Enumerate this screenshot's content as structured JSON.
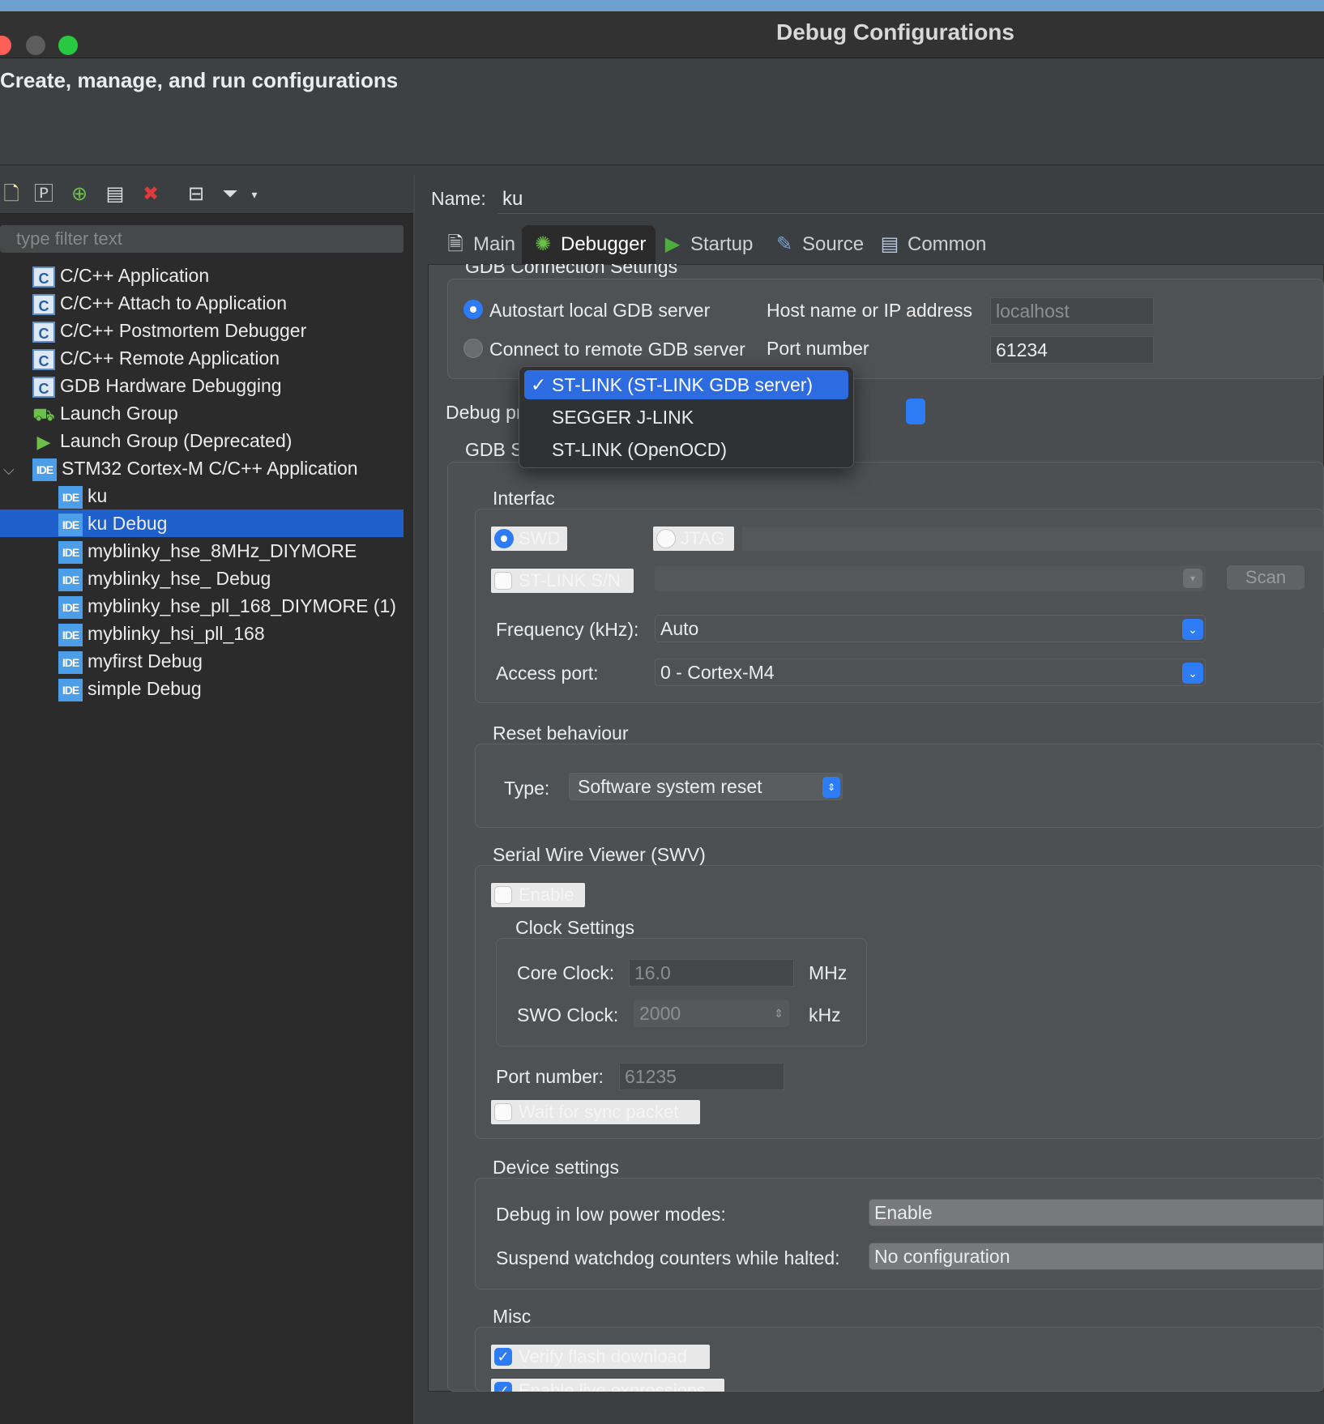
{
  "window": {
    "title": "Debug Configurations",
    "header": "Create, manage, and run configurations",
    "colors": {
      "accent": "#2d7cf6",
      "selection": "#1f5fcc"
    }
  },
  "left": {
    "toolbar": [
      "new-configuration-icon",
      "new-prototype-icon",
      "export-icon",
      "duplicate-icon",
      "delete-icon",
      "collapse-all-icon",
      "filter-icon"
    ],
    "filter_placeholder": "type filter text",
    "tree": [
      {
        "label": "C/C++ Application",
        "icon": "c-icon"
      },
      {
        "label": "C/C++ Attach to Application",
        "icon": "c-icon"
      },
      {
        "label": "C/C++ Postmortem Debugger",
        "icon": "c-icon"
      },
      {
        "label": "C/C++ Remote Application",
        "icon": "c-icon"
      },
      {
        "label": "GDB Hardware Debugging",
        "icon": "c-icon"
      },
      {
        "label": "Launch Group",
        "icon": "launch-group-icon"
      },
      {
        "label": "Launch Group (Deprecated)",
        "icon": "launch-group-icon"
      },
      {
        "label": "STM32 Cortex-M C/C++ Application",
        "icon": "ide-icon"
      },
      {
        "label": "ku",
        "icon": "ide-icon"
      },
      {
        "label": "ku Debug",
        "icon": "ide-icon"
      },
      {
        "label": "myblinky_hse_8MHz_DIYMORE",
        "icon": "ide-icon"
      },
      {
        "label": "myblinky_hse_ Debug",
        "icon": "ide-icon"
      },
      {
        "label": "myblinky_hse_pll_168_DIYMORE (1)",
        "icon": "ide-icon"
      },
      {
        "label": "myblinky_hsi_pll_168",
        "icon": "ide-icon"
      },
      {
        "label": "myfirst Debug",
        "icon": "ide-icon"
      },
      {
        "label": "simple Debug",
        "icon": "ide-icon"
      }
    ],
    "ide_icon_text": "IDE",
    "c_icon_text": "C"
  },
  "right": {
    "name_label": "Name:",
    "name_value": "ku",
    "tabs": [
      "Main",
      "Debugger",
      "Startup",
      "Source",
      "Common"
    ],
    "active_tab": "Debugger",
    "gdb_connection": {
      "title": "GDB Connection Settings",
      "autostart": "Autostart local GDB server",
      "remote": "Connect to remote GDB server",
      "host_label": "Host name or IP address",
      "host_value": "localhost",
      "port_label": "Port number",
      "port_value": "61234"
    },
    "debug_probe": {
      "label": "Debug probe",
      "options": [
        "ST-LINK (ST-LINK GDB server)",
        "SEGGER J-LINK",
        "ST-LINK (OpenOCD)"
      ],
      "selected": "ST-LINK (ST-LINK GDB server)",
      "check": "✓"
    },
    "gdb_server": {
      "title": "GDB Serve",
      "interface_title": "Interfac",
      "swd": "SWD",
      "jtag": "JTAG",
      "stlink_sn": "ST-LINK S/N",
      "scan": "Scan",
      "frequency_label": "Frequency (kHz):",
      "frequency_value": "Auto",
      "access_port_label": "Access port:",
      "access_port_value": "0 - Cortex-M4"
    },
    "reset": {
      "title": "Reset behaviour",
      "type_label": "Type:",
      "type_value": "Software system reset"
    },
    "swv": {
      "title": "Serial Wire Viewer (SWV)",
      "enable": "Enable",
      "clock_title": "Clock Settings",
      "core_clock_label": "Core Clock:",
      "core_clock_value": "16.0",
      "core_clock_unit": "MHz",
      "swo_clock_label": "SWO Clock:",
      "swo_clock_value": "2000",
      "swo_clock_unit": "kHz",
      "port_label": "Port number:",
      "port_value": "61235",
      "wait_sync": "Wait for sync packet"
    },
    "device": {
      "title": "Device settings",
      "low_power_label": "Debug in low power modes:",
      "low_power_value": "Enable",
      "watchdog_label": "Suspend watchdog counters while halted:",
      "watchdog_value": "No configuration"
    },
    "misc": {
      "title": "Misc",
      "verify_flash": "Verify flash download",
      "live_expressions": "Enable live expressions"
    }
  }
}
